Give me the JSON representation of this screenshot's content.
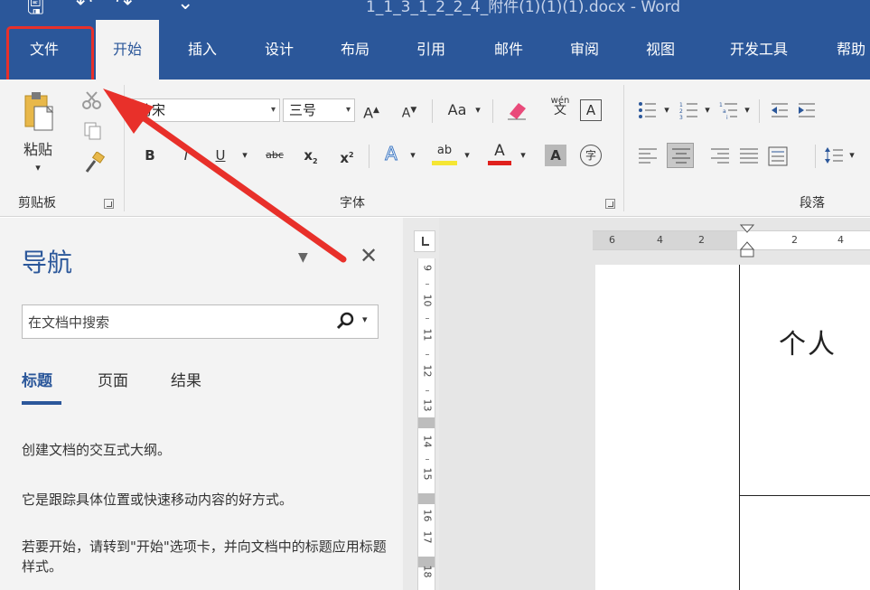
{
  "window": {
    "title": "1_1_3_1_2_2_4_附件(1)(1)(1).docx  -  Word"
  },
  "ribbon_tabs": [
    {
      "label": "文件"
    },
    {
      "label": "开始"
    },
    {
      "label": "插入"
    },
    {
      "label": "设计"
    },
    {
      "label": "布局"
    },
    {
      "label": "引用"
    },
    {
      "label": "邮件"
    },
    {
      "label": "审阅"
    },
    {
      "label": "视图"
    },
    {
      "label": "开发工具"
    },
    {
      "label": "帮助"
    }
  ],
  "active_tab": "开始",
  "clipboard": {
    "paste_label": "粘贴",
    "group_label": "剪贴板"
  },
  "font": {
    "font_name": "仿宋",
    "font_size": "三号",
    "grow": "A",
    "shrink": "A",
    "change_case": "Aa",
    "phonetic_top": "wén",
    "phonetic_bottom": "文",
    "border_char": "A",
    "bold": "B",
    "italic": "I",
    "underline": "U",
    "strikethrough": "abc",
    "subscript": "x",
    "superscript": "x",
    "text_effect": "A",
    "highlight": "ab",
    "font_color": "A",
    "char_shading": "A",
    "enclose": "字",
    "group_label": "字体"
  },
  "paragraph": {
    "group_label": "段落"
  },
  "navigation": {
    "title": "导航",
    "close_glyph": "✕",
    "search_placeholder": "在文档中搜索",
    "tabs": [
      {
        "label": "标题"
      },
      {
        "label": "页面"
      },
      {
        "label": "结果"
      }
    ],
    "active_tab": "标题",
    "messages": [
      "创建文档的交互式大纲。",
      "它是跟踪具体位置或快速移动内容的好方式。",
      "若要开始，请转到\"开始\"选项卡，并向文档中的标题应用标题样式。"
    ]
  },
  "horizontal_ruler": {
    "labels": [
      "6",
      "4",
      "2",
      "2",
      "4"
    ]
  },
  "vertical_ruler": {
    "labels": [
      "9",
      "10",
      "11",
      "12",
      "13",
      "14",
      "15",
      "16",
      "17",
      "18"
    ]
  },
  "document": {
    "visible_text": "个人"
  },
  "colors": {
    "ribbon_blue": "#2b579a",
    "highlight_red": "#e8302a"
  }
}
